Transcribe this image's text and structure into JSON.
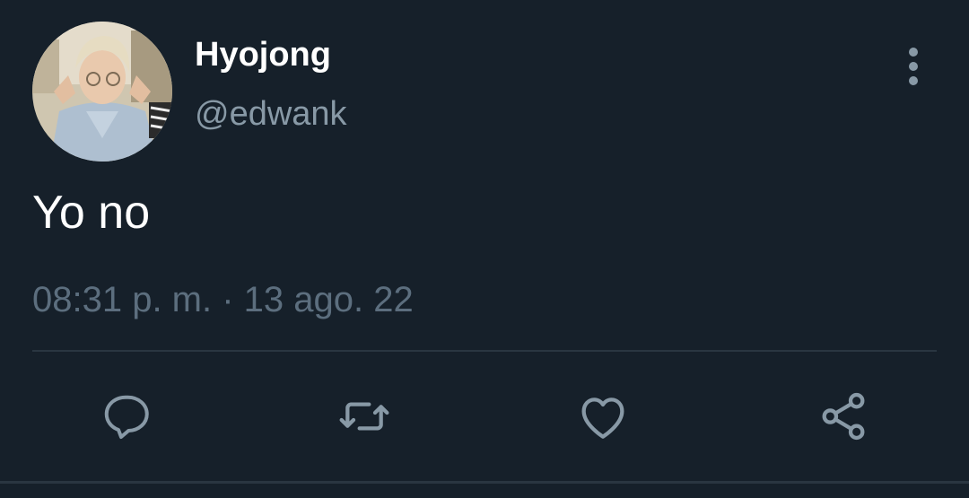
{
  "tweet": {
    "author": {
      "display_name": "Hyojong",
      "handle": "@edwank"
    },
    "text": "Yo no",
    "timestamp": "08:31 p. m. · 13 ago. 22"
  },
  "actions": [
    {
      "icon": "reply-icon"
    },
    {
      "icon": "retweet-icon"
    },
    {
      "icon": "like-icon"
    },
    {
      "icon": "share-icon"
    }
  ],
  "colors": {
    "background": "#16202a",
    "primary_text": "#ffffff",
    "secondary_text": "#8899a6",
    "muted_text": "#5c6e7e",
    "divider": "#2a3641",
    "icon": "#8899a6"
  }
}
